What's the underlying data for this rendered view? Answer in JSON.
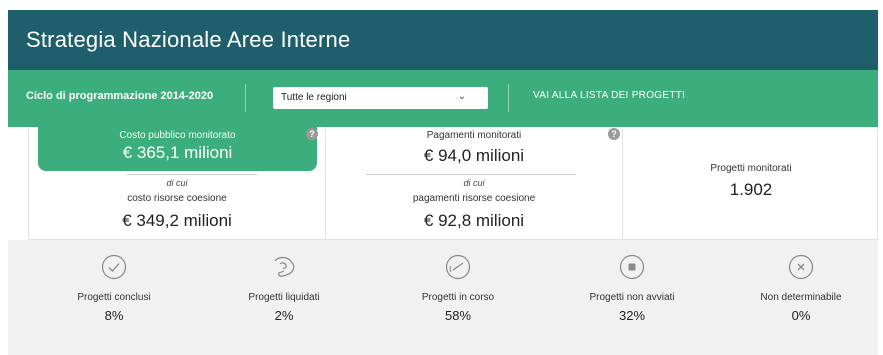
{
  "header": {
    "title": "Strategia Nazionale Aree Interne"
  },
  "filters": {
    "cycle_label": "Ciclo di programmazione 2014-2020",
    "region_select": "Tutte le regioni",
    "projects_link": "VAI ALLA LISTA DEI PROGETTI"
  },
  "stats": {
    "costo": {
      "label": "Costo pubblico monitorato",
      "value": "€ 365,1 milioni",
      "of_which": "di cui",
      "sub_label": "costo risorse coesione",
      "sub_value": "€ 349,2 milioni"
    },
    "pagamenti": {
      "label": "Pagamenti monitorati",
      "value": "€ 94,0 milioni",
      "of_which": "di cui",
      "sub_label": "pagamenti risorse coesione",
      "sub_value": "€ 92,8 milioni"
    },
    "progetti": {
      "label": "Progetti monitorati",
      "value": "1.902"
    },
    "help_glyph": "?"
  },
  "status": [
    {
      "icon": "check-circle-icon",
      "label": "Progetti conclusi",
      "value": "8%"
    },
    {
      "icon": "hand-money-icon",
      "label": "Progetti liquidati",
      "value": "2%"
    },
    {
      "icon": "gauge-icon",
      "label": "Progetti in corso",
      "value": "58%"
    },
    {
      "icon": "stop-circle-icon",
      "label": "Progetti non avviati",
      "value": "32%"
    },
    {
      "icon": "x-circle-icon",
      "label": "Non determinabile",
      "value": "0%"
    }
  ],
  "colors": {
    "header": "#1f5f6c",
    "accent_green": "#3cae7d",
    "status_bg": "#f1f1f1"
  }
}
